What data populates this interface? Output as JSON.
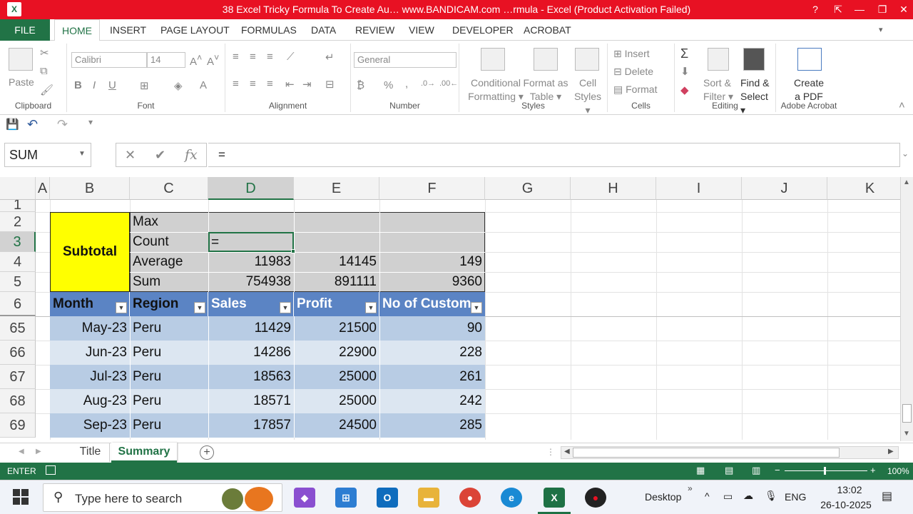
{
  "titlebar": {
    "app_icon": "X",
    "title": "38 Excel Tricky Formula To Create Au… www.BANDICAM.com …rmula - Excel (Product Activation Failed)",
    "help": "?",
    "restore_ribbon": "⇱",
    "minimize": "—",
    "maximize": "❐",
    "close": "✕"
  },
  "menu": {
    "file": "FILE",
    "tabs": [
      "HOME",
      "INSERT",
      "PAGE LAYOUT",
      "FORMULAS",
      "DATA",
      "REVIEW",
      "VIEW",
      "DEVELOPER",
      "ACROBAT"
    ]
  },
  "ribbon": {
    "clipboard": {
      "label": "Clipboard",
      "paste": "Paste"
    },
    "font": {
      "label": "Font",
      "font_name": "Calibri",
      "font_size": "14",
      "bold": "B",
      "italic": "I",
      "underline": "U"
    },
    "alignment": {
      "label": "Alignment"
    },
    "number": {
      "label": "Number",
      "format": "General",
      "percent": "%",
      "comma": ","
    },
    "styles": {
      "label": "Styles",
      "conditional": [
        "Conditional",
        "Formatting ▾"
      ],
      "format_table": [
        "Format as",
        "Table ▾"
      ],
      "cell_styles": [
        "Cell",
        "Styles ▾"
      ]
    },
    "cells": {
      "label": "Cells",
      "insert": "Insert",
      "delete": "Delete",
      "format": "Format"
    },
    "editing": {
      "label": "Editing",
      "sort": [
        "Sort &",
        "Filter ▾"
      ],
      "find": [
        "Find &",
        "Select ▾"
      ]
    },
    "acrobat": {
      "label": "Adobe Acrobat",
      "create": [
        "Create",
        "a PDF"
      ]
    }
  },
  "formula_bar": {
    "name_box": "SUM",
    "cancel": "✕",
    "enter": "✔",
    "fx": "fx",
    "formula": "="
  },
  "sheet": {
    "columns": [
      "A",
      "B",
      "C",
      "D",
      "E",
      "F",
      "G",
      "H",
      "I",
      "J",
      "K"
    ],
    "row_numbers": [
      "1",
      "2",
      "3",
      "4",
      "5",
      "6",
      "65",
      "66",
      "67",
      "68",
      "69"
    ],
    "subtotal_label": "Subtotal",
    "stats": [
      {
        "label": "Max",
        "d": "",
        "e": "",
        "f": ""
      },
      {
        "label": "Count",
        "d": "=",
        "e": "",
        "f": ""
      },
      {
        "label": "Average",
        "d": "11983",
        "e": "14145",
        "f": "149"
      },
      {
        "label": "Sum",
        "d": "754938",
        "e": "891111",
        "f": "9360"
      }
    ],
    "headers": [
      "Month",
      "Region",
      "Sales",
      "Profit",
      "No of Custome"
    ],
    "rows": [
      {
        "month": "May-23",
        "region": "Peru",
        "sales": "11429",
        "profit": "21500",
        "customers": "90"
      },
      {
        "month": "Jun-23",
        "region": "Peru",
        "sales": "14286",
        "profit": "22900",
        "customers": "228"
      },
      {
        "month": "Jul-23",
        "region": "Peru",
        "sales": "18563",
        "profit": "25000",
        "customers": "261"
      },
      {
        "month": "Aug-23",
        "region": "Peru",
        "sales": "18571",
        "profit": "25000",
        "customers": "242"
      },
      {
        "month": "Sep-23",
        "region": "Peru",
        "sales": "17857",
        "profit": "24500",
        "customers": "285"
      }
    ]
  },
  "sheet_tabs": {
    "tabs": [
      "Title",
      "Summary"
    ],
    "active": "Summary",
    "add": "+"
  },
  "status": {
    "mode": "ENTER",
    "zoom": "100%"
  },
  "taskbar": {
    "search_placeholder": "Type here to search",
    "desktop": "Desktop",
    "lang": "ENG",
    "time": "13:02",
    "date": "26-10-2025"
  },
  "colors": {
    "excel_green": "#217346",
    "title_red": "#e81123",
    "subtotal_yellow": "#ffff00",
    "header_blue": "#5b84c4",
    "band_dark": "#b8cce4",
    "band_light": "#dce6f1",
    "stat_gray": "#d0d0d0"
  }
}
